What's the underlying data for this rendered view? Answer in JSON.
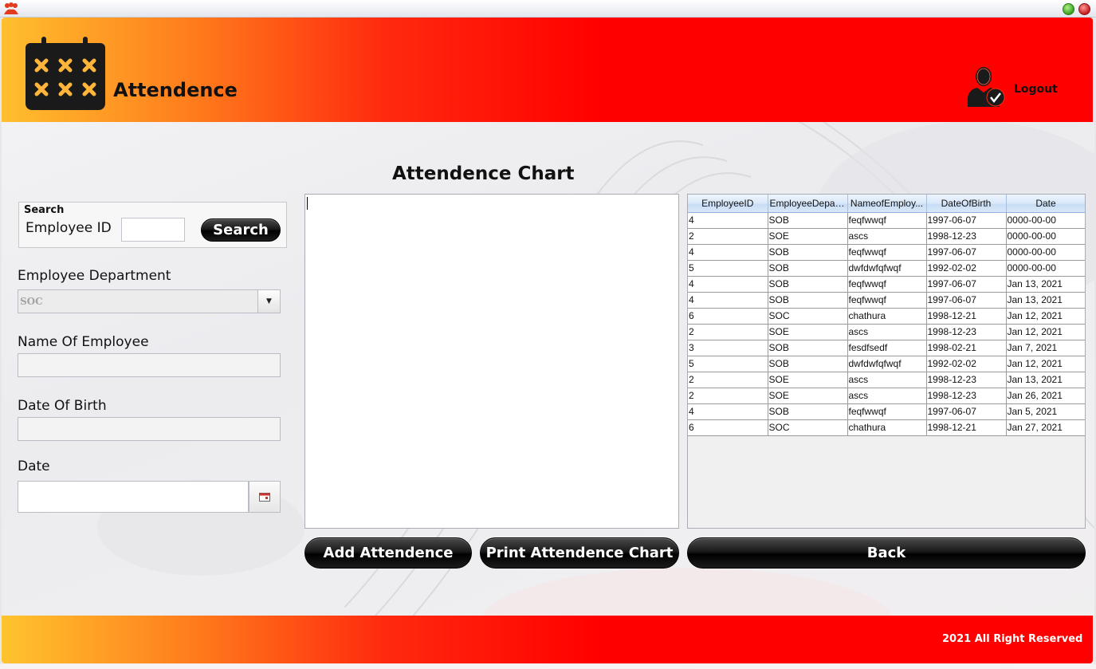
{
  "header": {
    "title": "Attendence",
    "logout_label": "Logout"
  },
  "chart": {
    "title": "Attendence Chart"
  },
  "search": {
    "legend": "Search",
    "employee_id_label": "Employee ID",
    "employee_id_value": "",
    "button_label": "Search"
  },
  "form": {
    "department_label": "Employee Department",
    "department_value": "SOC",
    "name_label": "Name Of Employee",
    "name_value": "",
    "dob_label": "Date Of Birth",
    "dob_value": "",
    "date_label": "Date",
    "date_value": ""
  },
  "table": {
    "columns": [
      "EmployeeID",
      "EmployeeDepar...",
      "NameofEmploy...",
      "DateOfBirth",
      "Date"
    ],
    "rows": [
      [
        "4",
        "SOB",
        "feqfwwqf",
        "1997-06-07",
        "0000-00-00"
      ],
      [
        "2",
        "SOE",
        "ascs",
        "1998-12-23",
        "0000-00-00"
      ],
      [
        "4",
        "SOB",
        "feqfwwqf",
        "1997-06-07",
        "0000-00-00"
      ],
      [
        "5",
        "SOB",
        "dwfdwfqfwqf",
        "1992-02-02",
        "0000-00-00"
      ],
      [
        "4",
        "SOB",
        "feqfwwqf",
        "1997-06-07",
        "Jan 13, 2021"
      ],
      [
        "4",
        "SOB",
        "feqfwwqf",
        "1997-06-07",
        "Jan 13, 2021"
      ],
      [
        "6",
        "SOC",
        "chathura",
        "1998-12-21",
        "Jan 12, 2021"
      ],
      [
        "2",
        "SOE",
        "ascs",
        "1998-12-23",
        "Jan 12, 2021"
      ],
      [
        "3",
        "SOB",
        "fesdfsedf",
        "1998-02-21",
        "Jan 7, 2021"
      ],
      [
        "5",
        "SOB",
        "dwfdwfqfwqf",
        "1992-02-02",
        "Jan 12, 2021"
      ],
      [
        "2",
        "SOE",
        "ascs",
        "1998-12-23",
        "Jan 13, 2021"
      ],
      [
        "2",
        "SOE",
        "ascs",
        "1998-12-23",
        "Jan 26, 2021"
      ],
      [
        "4",
        "SOB",
        "feqfwwqf",
        "1997-06-07",
        "Jan 5, 2021"
      ],
      [
        "6",
        "SOC",
        "chathura",
        "1998-12-21",
        "Jan 27, 2021"
      ]
    ]
  },
  "buttons": {
    "add": "Add Attendence",
    "print": "Print Attendence Chart",
    "back": "Back"
  },
  "footer": {
    "copyright": "2021 All Right Reserved"
  },
  "colors": {
    "header_red": "#ff0000",
    "header_yellow": "#ffbf2e",
    "button_black": "#000000",
    "table_header_blue": "#d9e8f9"
  },
  "icons": [
    "app-icon",
    "calendar-icon",
    "user-check-icon",
    "chevron-down-icon",
    "calendar-small-icon"
  ]
}
